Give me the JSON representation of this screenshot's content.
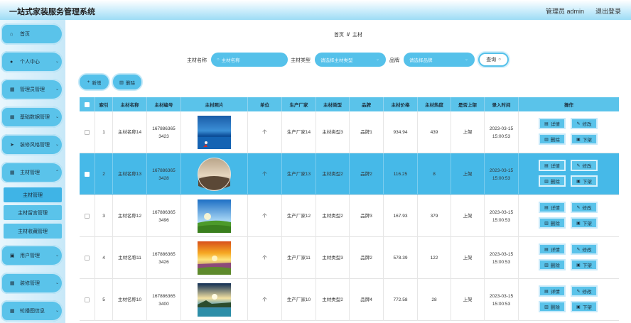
{
  "app": {
    "title": "一站式家装服务管理系统",
    "user_label": "管理员 admin",
    "logout_label": "退出登录"
  },
  "sidebar": {
    "items": [
      {
        "label": "首页",
        "icon": "home-icon",
        "glyph": "⌂",
        "chevron": false
      },
      {
        "label": "个人中心",
        "icon": "user-icon",
        "glyph": "●",
        "chevron": true
      },
      {
        "label": "管理员管理",
        "icon": "grid-icon",
        "glyph": "▦",
        "chevron": true
      },
      {
        "label": "基础数据管理",
        "icon": "grid-icon",
        "glyph": "▦",
        "chevron": true
      },
      {
        "label": "装修风格管理",
        "icon": "send-icon",
        "glyph": "➤",
        "chevron": true
      },
      {
        "label": "主材管理",
        "icon": "grid-icon",
        "glyph": "▦",
        "chevron": true
      },
      {
        "label": "用户管理",
        "icon": "clipboard-icon",
        "glyph": "▣",
        "chevron": true
      },
      {
        "label": "装修管理",
        "icon": "grid-icon",
        "glyph": "▦",
        "chevron": true
      },
      {
        "label": "轮播图信息",
        "icon": "grid-icon",
        "glyph": "▦",
        "chevron": true
      }
    ],
    "sub_items": [
      {
        "label": "主材管理"
      },
      {
        "label": "主材留言管理"
      },
      {
        "label": "主材收藏管理"
      }
    ]
  },
  "breadcrumb": {
    "home": "首页",
    "sep": "//",
    "current": "主材"
  },
  "search": {
    "name_label": "主材名称",
    "name_placeholder": "主材名称",
    "type_label": "主材类型",
    "type_placeholder": "请选择主材类型",
    "brand_label": "品牌",
    "brand_placeholder": "请选择品牌",
    "query_label": "查询"
  },
  "actions": {
    "add_label": "新增",
    "delete_label": "删除"
  },
  "table": {
    "headers": [
      "",
      "索引",
      "主材名称",
      "主材编号",
      "主材照片",
      "单位",
      "生产厂家",
      "主材类型",
      "品牌",
      "主材价格",
      "主材热度",
      "是否上架",
      "录入时间",
      "操作"
    ],
    "ops": {
      "detail": "详情",
      "edit": "修改",
      "delete": "删除",
      "offshelf": "下架"
    },
    "rows": [
      {
        "index": "1",
        "name": "主材名称14",
        "code_a": "167886365",
        "code_b": "3423",
        "unit": "个",
        "maker": "生产厂家14",
        "type": "主材类型3",
        "brand": "品牌1",
        "price": "934.94",
        "heat": "439",
        "shelf": "上架",
        "date": "2023-03-15",
        "time": "15:00:53"
      },
      {
        "index": "2",
        "name": "主材名称13",
        "code_a": "167886365",
        "code_b": "3428",
        "unit": "个",
        "maker": "生产厂家13",
        "type": "主材类型2",
        "brand": "品牌2",
        "price": "116.25",
        "heat": "8",
        "shelf": "上架",
        "date": "2023-03-15",
        "time": "15:00:53"
      },
      {
        "index": "3",
        "name": "主材名称12",
        "code_a": "167886365",
        "code_b": "3496",
        "unit": "个",
        "maker": "生产厂家12",
        "type": "主材类型2",
        "brand": "品牌3",
        "price": "167.93",
        "heat": "379",
        "shelf": "上架",
        "date": "2023-03-15",
        "time": "15:00:53"
      },
      {
        "index": "4",
        "name": "主材名称11",
        "code_a": "167886365",
        "code_b": "3426",
        "unit": "个",
        "maker": "生产厂家11",
        "type": "主材类型3",
        "brand": "品牌2",
        "price": "578.39",
        "heat": "122",
        "shelf": "上架",
        "date": "2023-03-15",
        "time": "15:00:53"
      },
      {
        "index": "5",
        "name": "主材名称10",
        "code_a": "167886365",
        "code_b": "3400",
        "unit": "个",
        "maker": "生产厂家10",
        "type": "主材类型2",
        "brand": "品牌4",
        "price": "772.58",
        "heat": "28",
        "shelf": "上架",
        "date": "2023-03-15",
        "time": "15:00:53"
      }
    ]
  },
  "colors": {
    "accent": "#5ac3ea",
    "selected_row": "#46b9e8"
  }
}
